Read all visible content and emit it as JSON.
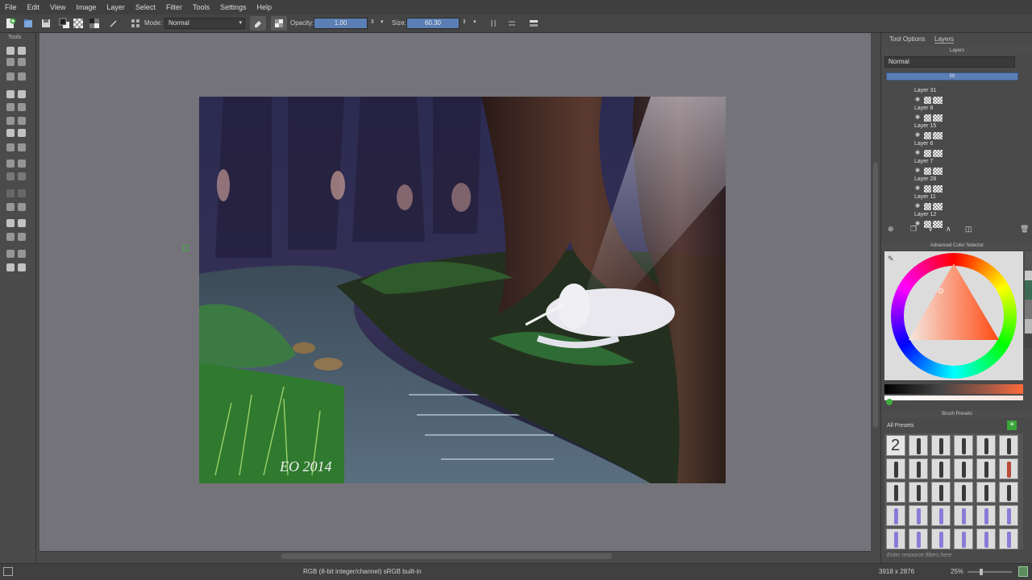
{
  "menu": [
    "File",
    "Edit",
    "View",
    "Image",
    "Layer",
    "Select",
    "Filter",
    "Tools",
    "Settings",
    "Help"
  ],
  "toolbar": {
    "mode_label": "Mode:",
    "mode_value": "Normal",
    "opacity_label": "Opacity:",
    "opacity_value": "1.00",
    "size_label": "Size:",
    "size_value": "60.30"
  },
  "toolbox": {
    "title": "Tools"
  },
  "docker": {
    "tabs": [
      "Tool Options",
      "Layers"
    ],
    "layers_header": "Layers",
    "blend_mode": "Normal",
    "opacity_bar_value": "50",
    "layers": [
      "Layer 31",
      "Layer 8",
      "Layer 15",
      "Layer 6",
      "Layer 7",
      "Layer 28",
      "Layer 11",
      "Layer 12"
    ],
    "color_selector_title": "Advanced Color Selector",
    "brush_presets_title": "Brush Presets",
    "presets_filter": "All Presets",
    "preset_number": "2",
    "filter_placeholder": "Enter resource filters here"
  },
  "status": {
    "colorspace": "RGB (8-bit integer/channel)  sRGB built-in",
    "dimensions": "3918 x 2876",
    "zoom": "25%"
  },
  "artwork": {
    "signature": "EO 2014"
  },
  "colors": {
    "canvas_bg": "#75737a",
    "accent": "#5b7fb4",
    "active_green": "#3fae3f"
  }
}
